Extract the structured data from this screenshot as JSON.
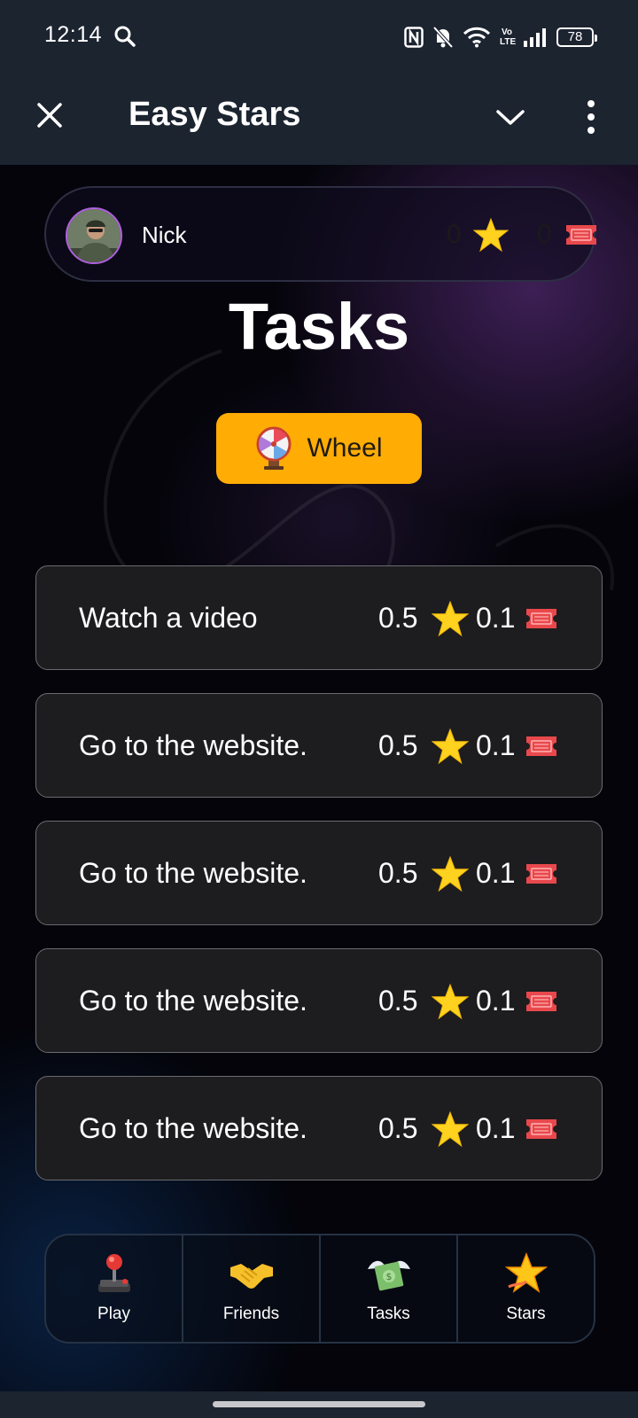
{
  "status_bar": {
    "time": "12:14",
    "battery": "78",
    "network_label": "Vo LTE"
  },
  "app_bar": {
    "title": "Easy Stars"
  },
  "user": {
    "name": "Nick",
    "stars": "0",
    "tickets": "0"
  },
  "page": {
    "title": "Tasks"
  },
  "wheel_button": {
    "label": "Wheel"
  },
  "tasks": [
    {
      "label": "Watch a video",
      "stars": "0.5",
      "tickets": "0.1"
    },
    {
      "label": "Go to the website.",
      "stars": "0.5",
      "tickets": "0.1"
    },
    {
      "label": "Go to the website.",
      "stars": "0.5",
      "tickets": "0.1"
    },
    {
      "label": "Go to the website.",
      "stars": "0.5",
      "tickets": "0.1"
    },
    {
      "label": "Go to the website.",
      "stars": "0.5",
      "tickets": "0.1"
    }
  ],
  "bottom_nav": [
    {
      "label": "Play",
      "icon": "joystick-icon"
    },
    {
      "label": "Friends",
      "icon": "handshake-icon"
    },
    {
      "label": "Tasks",
      "icon": "money-with-wings-icon"
    },
    {
      "label": "Stars",
      "icon": "star-icon"
    }
  ],
  "colors": {
    "wheel_button": "#ffac05",
    "star": "#ffd21f",
    "ticket": "#e8484c",
    "avatar_ring": "#b05ee0",
    "bar_background": "#1c2430"
  }
}
